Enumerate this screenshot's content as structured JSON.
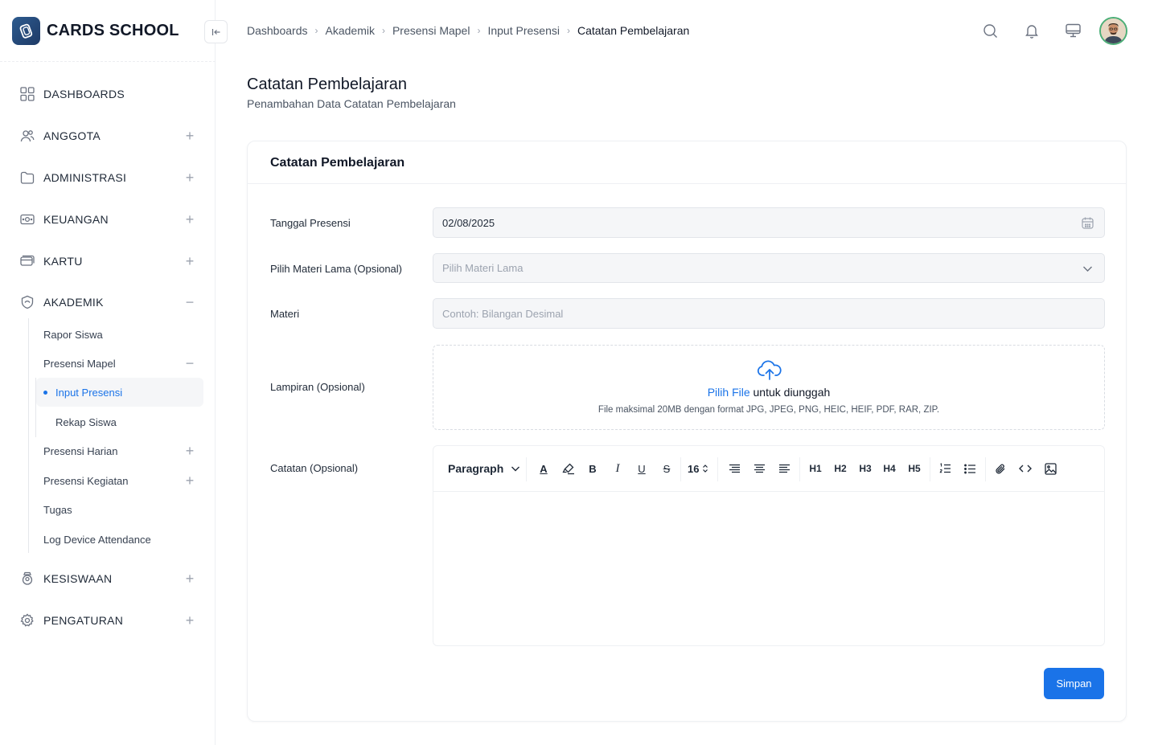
{
  "brand": {
    "name": "CARDS SCHOOL"
  },
  "sidebar": {
    "items": [
      {
        "label": "DASHBOARDS",
        "icon": "grid-icon",
        "toggle": ""
      },
      {
        "label": "ANGGOTA",
        "icon": "users-icon",
        "toggle": "+"
      },
      {
        "label": "ADMINISTRASI",
        "icon": "folder-icon",
        "toggle": "+"
      },
      {
        "label": "KEUANGAN",
        "icon": "money-icon",
        "toggle": "+"
      },
      {
        "label": "KARTU",
        "icon": "card-icon",
        "toggle": "+"
      },
      {
        "label": "AKADEMIK",
        "icon": "academic-icon",
        "toggle": "−"
      },
      {
        "label": "KESISWAAN",
        "icon": "student-icon",
        "toggle": "+"
      },
      {
        "label": "PENGATURAN",
        "icon": "gear-icon",
        "toggle": "+"
      }
    ],
    "akademik_sub": [
      {
        "label": "Rapor Siswa",
        "toggle": ""
      },
      {
        "label": "Presensi Mapel",
        "toggle": "−"
      },
      {
        "label": "Presensi Harian",
        "toggle": "+"
      },
      {
        "label": "Presensi Kegiatan",
        "toggle": "+"
      },
      {
        "label": "Tugas",
        "toggle": ""
      },
      {
        "label": "Log Device Attendance",
        "toggle": ""
      }
    ],
    "presensi_mapel_sub": [
      {
        "label": "Input Presensi",
        "active": true
      },
      {
        "label": "Rekap Siswa",
        "active": false
      }
    ]
  },
  "breadcrumb": [
    "Dashboards",
    "Akademik",
    "Presensi Mapel",
    "Input Presensi",
    "Catatan Pembelajaran"
  ],
  "header": {
    "icons": [
      "search-icon",
      "bell-icon",
      "monitor-icon",
      "avatar"
    ]
  },
  "page": {
    "title": "Catatan Pembelajaran",
    "subtitle": "Penambahan Data Catatan Pembelajaran"
  },
  "card": {
    "title": "Catatan Pembelajaran",
    "fields": {
      "tanggal": {
        "label": "Tanggal Presensi",
        "value": "02/08/2025"
      },
      "materi_lama": {
        "label": "Pilih Materi Lama (Opsional)",
        "placeholder": "Pilih Materi Lama"
      },
      "materi": {
        "label": "Materi",
        "placeholder": "Contoh: Bilangan Desimal"
      },
      "lampiran": {
        "label": "Lampiran (Opsional)",
        "link": "Pilih File",
        "text": " untuk diunggah",
        "note": "File maksimal 20MB dengan format JPG, JPEG, PNG, HEIC, HEIF, PDF, RAR, ZIP."
      },
      "catatan": {
        "label": "Catatan (Opsional)"
      }
    },
    "editor": {
      "paragraph": "Paragraph",
      "font_size": "16",
      "headings": [
        "H1",
        "H2",
        "H3",
        "H4",
        "H5"
      ],
      "bold": "B",
      "italic": "I",
      "underline": "U",
      "strike": "S",
      "text_color": "A"
    },
    "save_label": "Simpan"
  },
  "colors": {
    "accent": "#1a73e8",
    "active_bg": "#f5f6f8"
  }
}
